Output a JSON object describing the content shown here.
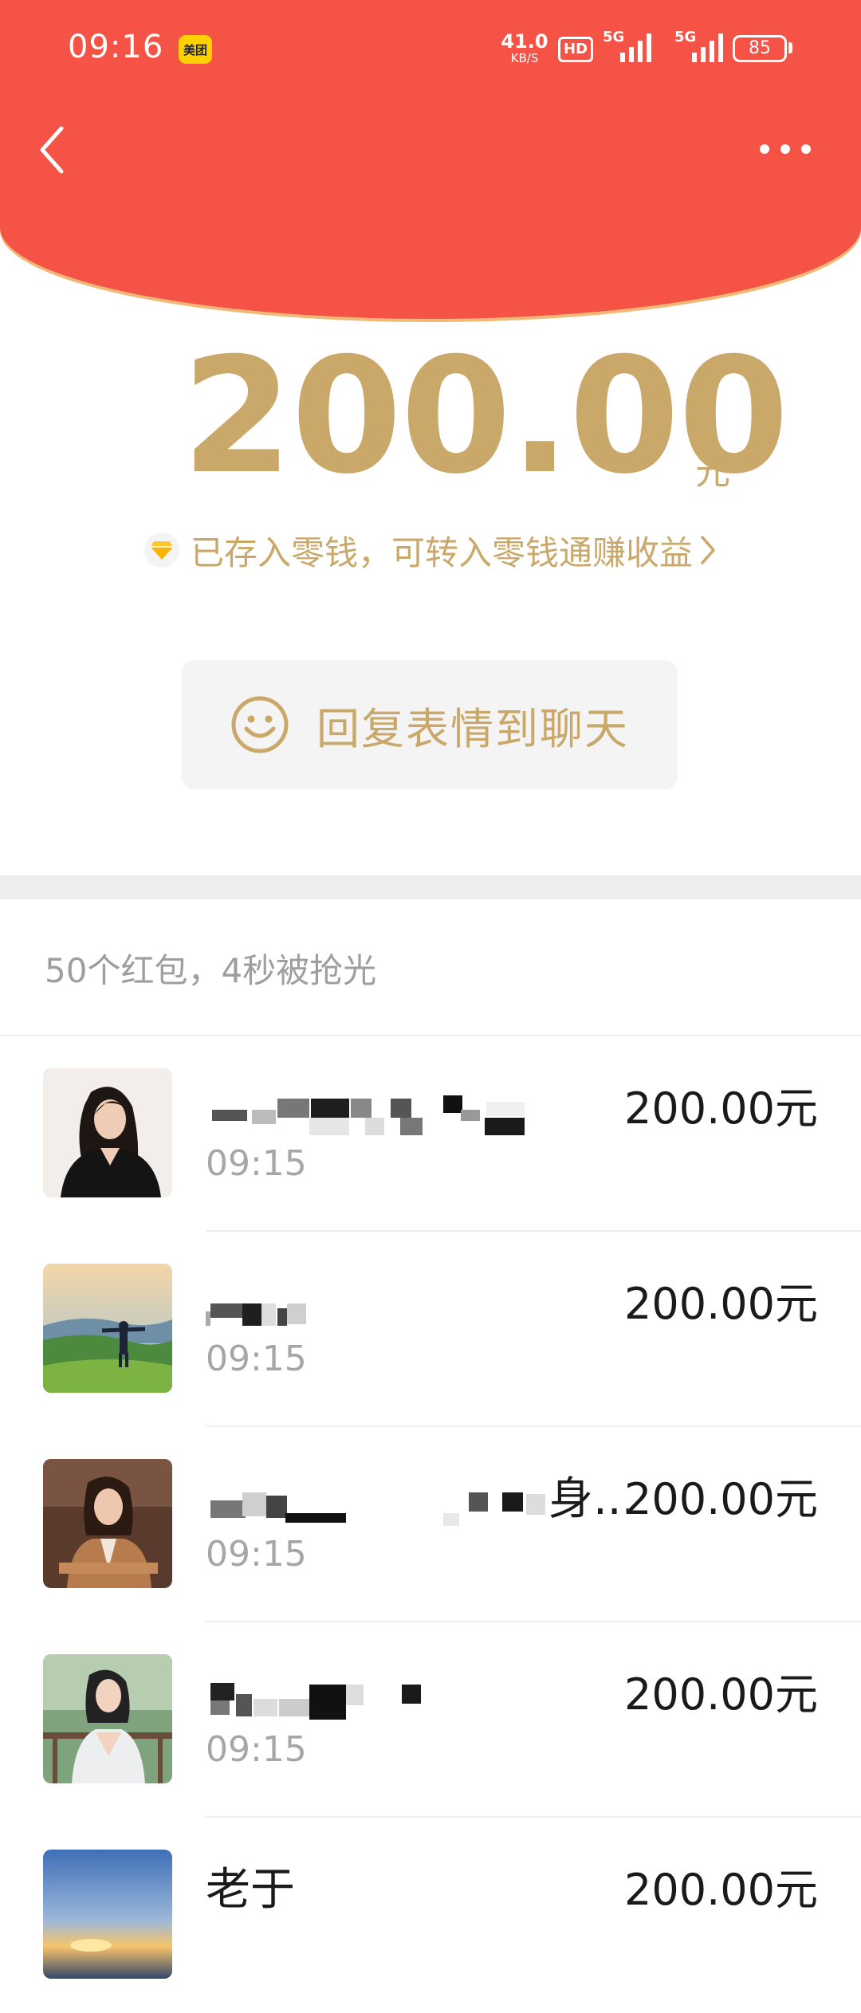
{
  "status_bar": {
    "time": "09:16",
    "app_badge": "美团",
    "net_speed_value": "41.0",
    "net_speed_unit": "KB/S",
    "hd_label": "HD",
    "signal1_label": "5G",
    "signal2_label": "5G",
    "battery": "85"
  },
  "header": {
    "accent_color": "#F45346",
    "back_icon": "chevron-left-icon",
    "more_icon": "more-horizontal-icon"
  },
  "packet": {
    "amount": "200.00",
    "unit": "元",
    "amount_color": "#C9A869",
    "change_note": "已存入零钱，可转入零钱通赚收益",
    "change_icon": "diamond-icon",
    "reply_button_label": "回复表情到聊天",
    "reply_icon": "smiley-icon"
  },
  "summary": {
    "text": "50个红包，4秒被抢光"
  },
  "recipients": [
    {
      "name": "",
      "time": "09:15",
      "amount": "200.00元",
      "avatar": "avatar-woman-black-jacket"
    },
    {
      "name": "",
      "time": "09:15",
      "amount": "200.00元",
      "avatar": "avatar-man-on-hill"
    },
    {
      "name": "身...",
      "time": "09:15",
      "amount": "200.00元",
      "avatar": "avatar-woman-brown-blazer"
    },
    {
      "name": "",
      "time": "09:15",
      "amount": "200.00元",
      "avatar": "avatar-woman-white-dress"
    },
    {
      "name": "老于",
      "time": "",
      "amount": "200.00元",
      "avatar": "avatar-sunset-sky"
    }
  ]
}
